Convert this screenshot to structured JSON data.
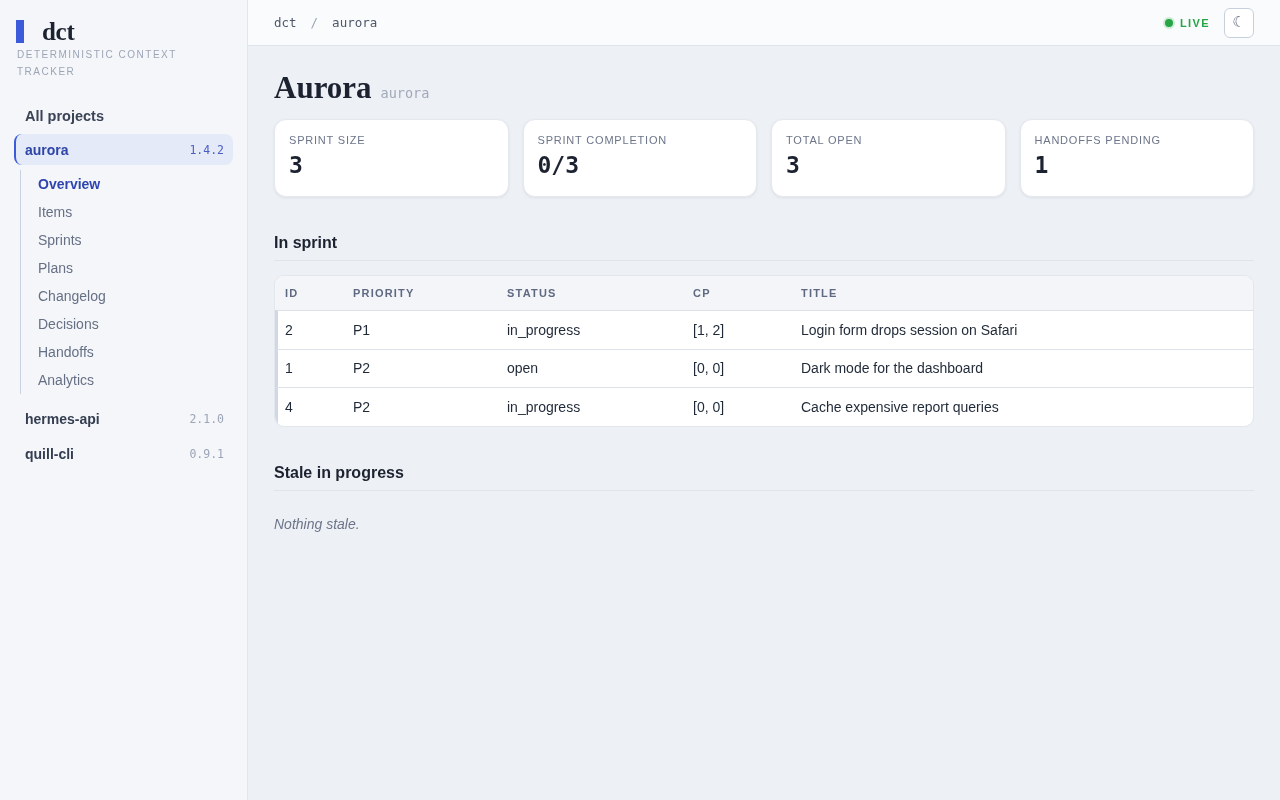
{
  "sidebar": {
    "logo": {
      "text": "dct",
      "subtitle": "DETERMINISTIC CONTEXT TRACKER"
    },
    "all_projects": {
      "label": "All projects"
    },
    "projects": [
      {
        "name": "aurora",
        "version": "1.4.2",
        "selected": true,
        "children": [
          {
            "label": "Overview",
            "selected": true
          },
          {
            "label": "Items",
            "selected": false
          },
          {
            "label": "Sprints",
            "selected": false
          },
          {
            "label": "Plans",
            "selected": false
          },
          {
            "label": "Changelog",
            "selected": false
          },
          {
            "label": "Decisions",
            "selected": false
          },
          {
            "label": "Handoffs",
            "selected": false
          },
          {
            "label": "Analytics",
            "selected": false
          }
        ]
      },
      {
        "name": "hermes-api",
        "version": "2.1.0",
        "selected": false
      },
      {
        "name": "quill-cli",
        "version": "0.9.1",
        "selected": false
      }
    ]
  },
  "topbar": {
    "breadcrumbs": [
      "dct",
      "aurora"
    ],
    "separator": "/",
    "status": {
      "label": "LIVE",
      "live": true
    },
    "theme_toggle": {
      "glyph": "☾"
    }
  },
  "page": {
    "title": "Aurora",
    "slug": "aurora"
  },
  "stats": [
    {
      "label": "SPRINT SIZE",
      "value": "3"
    },
    {
      "label": "SPRINT COMPLETION",
      "value": "0/3"
    },
    {
      "label": "TOTAL OPEN",
      "value": "3"
    },
    {
      "label": "HANDOFFS PENDING",
      "value": "1"
    }
  ],
  "sections": [
    {
      "kind": "table",
      "title": "In sprint",
      "table": {
        "columns": [
          "ID",
          "PRIORITY",
          "STATUS",
          "CP",
          "TITLE"
        ],
        "rows": [
          [
            "2",
            "P1",
            "in_progress",
            "[1, 2]",
            "Login form drops session on Safari"
          ],
          [
            "1",
            "P2",
            "open",
            "[0, 0]",
            "Dark mode for the dashboard"
          ],
          [
            "4",
            "P2",
            "in_progress",
            "[0, 0]",
            "Cache expensive report queries"
          ]
        ]
      }
    },
    {
      "kind": "empty",
      "title": "Stale in progress",
      "message": "Nothing stale."
    }
  ]
}
